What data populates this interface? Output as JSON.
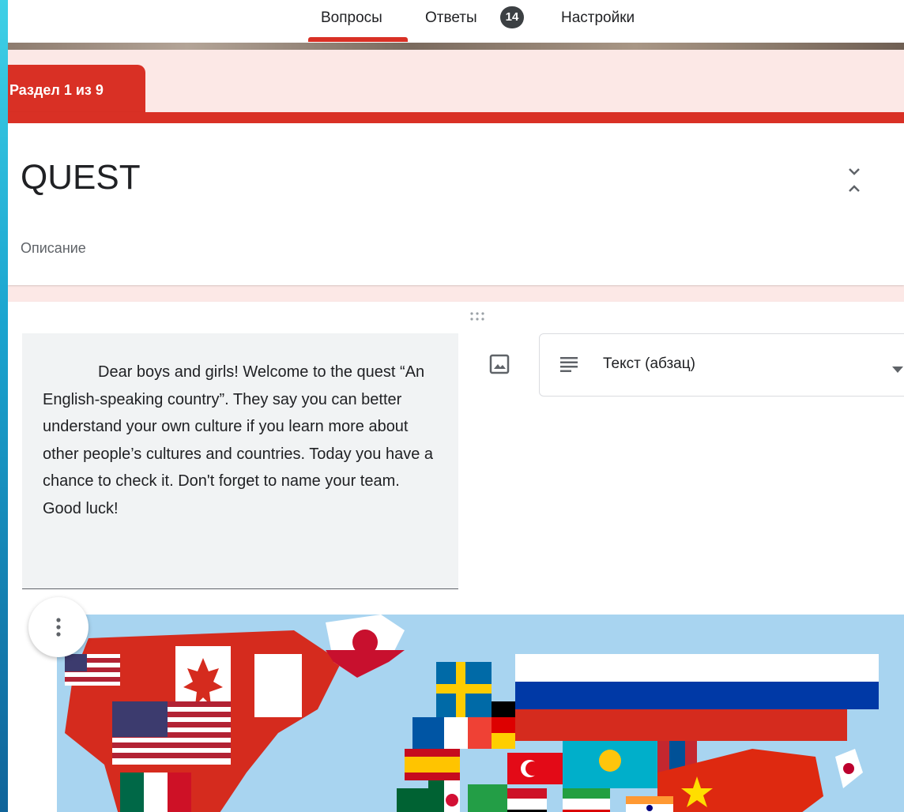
{
  "nav": {
    "tabs": [
      {
        "label": "Вопросы",
        "active": true
      },
      {
        "label": "Ответы",
        "badge": "14"
      },
      {
        "label": "Настройки"
      }
    ]
  },
  "section": {
    "label": "Раздел 1 из 9",
    "title": "QUEST",
    "description": "Описание"
  },
  "item": {
    "text": "Dear boys and girls! Welcome to the quest “An English-speaking country”. They say you can better understand your own culture if you learn more about other people’s cultures and countries. Today you have a chance to check it. Don't forget to name your team. Good luck!",
    "type_label": "Текст (абзац)"
  },
  "icons": {
    "collapse": "collapse-icon",
    "drag": "drag-handle-icon",
    "image": "image-icon",
    "paragraph": "paragraph-icon",
    "caret": "dropdown-caret-icon",
    "more": "more-vert-icon"
  },
  "colors": {
    "accent": "#d93025",
    "section_bg": "#fce8e6",
    "text_block_bg": "#f1f3f4",
    "map_water": "#a8d4f0"
  }
}
